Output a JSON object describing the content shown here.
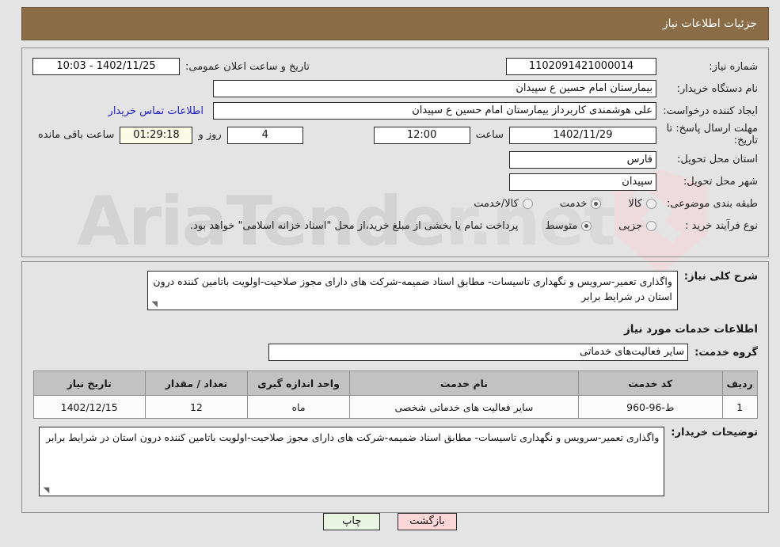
{
  "header": {
    "title": "جزئیات اطلاعات نیاز"
  },
  "form": {
    "need_number_label": "شماره نیاز:",
    "need_number_value": "1102091421000014",
    "announce_label": "تاریخ و ساعت اعلان عمومی:",
    "announce_value": "10:03 - 1402/11/25",
    "buyer_org_label": "نام دستگاه خریدار:",
    "buyer_org_value": "بیمارستان امام حسین  ع  سپیدان",
    "creator_label": "ایجاد کننده درخواست:",
    "creator_value": "علی  هوشمندی کاربرداز  بیمارستان امام حسین  ع  سپیدان",
    "contact_link": "اطلاعات تماس خریدار",
    "deadline_label_line1": "مهلت ارسال پاسخ: تا",
    "deadline_label_line2": "تاریخ:",
    "deadline_date": "1402/11/29",
    "hour_label": "ساعت",
    "deadline_hour": "12:00",
    "days_value": "4",
    "days_label": "روز و",
    "remaining_time": "01:29:18",
    "remaining_label": "ساعت باقی مانده",
    "province_label": "استان محل تحویل:",
    "province_value": "فارس",
    "city_label": "شهر محل تحویل:",
    "city_value": "سپیدان",
    "category_label": "طبقه بندی موضوعی:",
    "category_options": [
      {
        "label": "کالا",
        "checked": false
      },
      {
        "label": "خدمت",
        "checked": true
      },
      {
        "label": "کالا/خدمت",
        "checked": false
      }
    ],
    "process_label": "نوع فرآیند خرید :",
    "process_options": [
      {
        "label": "جزیی",
        "checked": false
      },
      {
        "label": "متوسط",
        "checked": true
      }
    ],
    "process_note": "پرداخت تمام یا بخشی از مبلغ خرید،از محل \"اسناد خزانه اسلامی\" خواهد بود."
  },
  "need_summary": {
    "label": "شرح کلی نیاز:",
    "value": "واگذاری تعمیر-سرویس و نگهداری تاسیسات- مطابق اسناد ضمیمه-شرکت های دارای مجوز صلاحیت-اولویت باتامین کننده درون استان در شرایط برابر"
  },
  "services_section": {
    "heading": "اطلاعات خدمات مورد نیاز",
    "group_label": "گروه خدمت:",
    "group_value": "سایر فعالیت‌های خدماتی",
    "table": {
      "columns": [
        "ردیف",
        "کد خدمت",
        "نام خدمت",
        "واحد اندازه گیری",
        "تعداد / مقدار",
        "تاریخ نیاز"
      ],
      "rows": [
        {
          "radif": "1",
          "code": "ط-96-960",
          "name": "سایر فعالیت های خدماتی شخصی",
          "unit": "ماه",
          "quantity": "12",
          "need_date": "1402/12/15"
        }
      ]
    }
  },
  "buyer_notes": {
    "label": "توضیحات خریدار:",
    "value": "واگذاری تعمیر-سرویس و نگهداری تاسیسات- مطابق اسناد ضمیمه-شرکت های دارای مجوز صلاحیت-اولویت باتامین کننده درون استان در شرایط برابر"
  },
  "buttons": {
    "print": "چاپ",
    "back": "بازگشت"
  },
  "watermark": {
    "text_a": "AriaTende",
    "text_b": "r.net"
  }
}
